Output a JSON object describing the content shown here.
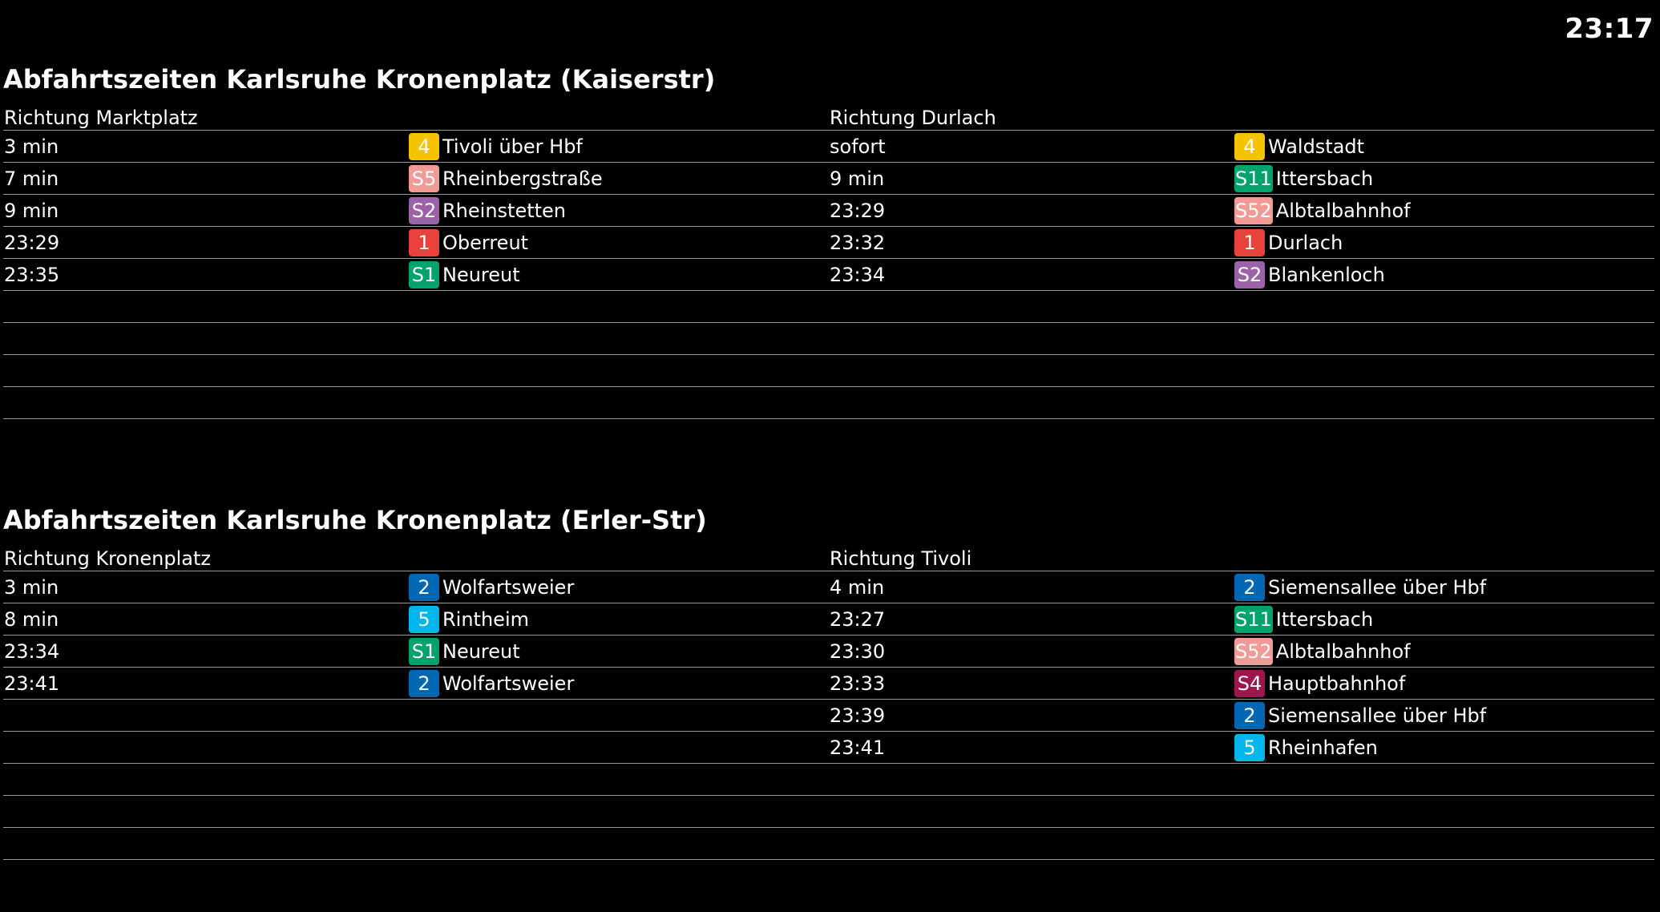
{
  "clock": "23:17",
  "stations": [
    {
      "title": "Abfahrtszeiten Karlsruhe Kronenplatz (Kaiserstr)",
      "directions": [
        {
          "header": "Richtung Marktplatz",
          "departures": [
            {
              "time": "3 min",
              "line": "4",
              "color": "#f5c400",
              "dest": "Tivoli über Hbf"
            },
            {
              "time": "7 min",
              "line": "S5",
              "color": "#f29a95",
              "dest": "Rheinbergstraße"
            },
            {
              "time": "9 min",
              "line": "S2",
              "color": "#9c62a9",
              "dest": "Rheinstetten"
            },
            {
              "time": "23:29",
              "line": "1",
              "color": "#e9423d",
              "dest": "Oberreut"
            },
            {
              "time": "23:35",
              "line": "S1",
              "color": "#00a36c",
              "dest": "Neureut"
            },
            {
              "time": "",
              "line": "",
              "color": "",
              "dest": ""
            },
            {
              "time": "",
              "line": "",
              "color": "",
              "dest": ""
            },
            {
              "time": "",
              "line": "",
              "color": "",
              "dest": ""
            },
            {
              "time": "",
              "line": "",
              "color": "",
              "dest": ""
            }
          ]
        },
        {
          "header": "Richtung Durlach",
          "departures": [
            {
              "time": "sofort",
              "line": "4",
              "color": "#f5c400",
              "dest": "Waldstadt"
            },
            {
              "time": "9 min",
              "line": "S11",
              "color": "#00a36c",
              "dest": "Ittersbach"
            },
            {
              "time": "23:29",
              "line": "S52",
              "color": "#f29a95",
              "dest": "Albtalbahnhof"
            },
            {
              "time": "23:32",
              "line": "1",
              "color": "#e9423d",
              "dest": "Durlach"
            },
            {
              "time": "23:34",
              "line": "S2",
              "color": "#9c62a9",
              "dest": "Blankenloch"
            },
            {
              "time": "",
              "line": "",
              "color": "",
              "dest": ""
            },
            {
              "time": "",
              "line": "",
              "color": "",
              "dest": ""
            },
            {
              "time": "",
              "line": "",
              "color": "",
              "dest": ""
            },
            {
              "time": "",
              "line": "",
              "color": "",
              "dest": ""
            }
          ]
        }
      ]
    },
    {
      "title": "Abfahrtszeiten Karlsruhe Kronenplatz (Erler-Str)",
      "directions": [
        {
          "header": "Richtung Kronenplatz",
          "departures": [
            {
              "time": "3 min",
              "line": "2",
              "color": "#0067b3",
              "dest": "Wolfartsweier"
            },
            {
              "time": "8 min",
              "line": "5",
              "color": "#00b6ea",
              "dest": "Rintheim"
            },
            {
              "time": "23:34",
              "line": "S1",
              "color": "#00a36c",
              "dest": "Neureut"
            },
            {
              "time": "23:41",
              "line": "2",
              "color": "#0067b3",
              "dest": "Wolfartsweier"
            },
            {
              "time": "",
              "line": "",
              "color": "",
              "dest": ""
            },
            {
              "time": "",
              "line": "",
              "color": "",
              "dest": ""
            },
            {
              "time": "",
              "line": "",
              "color": "",
              "dest": ""
            },
            {
              "time": "",
              "line": "",
              "color": "",
              "dest": ""
            },
            {
              "time": "",
              "line": "",
              "color": "",
              "dest": ""
            }
          ]
        },
        {
          "header": "Richtung Tivoli",
          "departures": [
            {
              "time": "4 min",
              "line": "2",
              "color": "#0067b3",
              "dest": "Siemensallee über Hbf"
            },
            {
              "time": "23:27",
              "line": "S11",
              "color": "#00a36c",
              "dest": "Ittersbach"
            },
            {
              "time": "23:30",
              "line": "S52",
              "color": "#f29a95",
              "dest": "Albtalbahnhof"
            },
            {
              "time": "23:33",
              "line": "S4",
              "color": "#a0154e",
              "dest": "Hauptbahnhof"
            },
            {
              "time": "23:39",
              "line": "2",
              "color": "#0067b3",
              "dest": "Siemensallee über Hbf"
            },
            {
              "time": "23:41",
              "line": "5",
              "color": "#00b6ea",
              "dest": "Rheinhafen"
            },
            {
              "time": "",
              "line": "",
              "color": "",
              "dest": ""
            },
            {
              "time": "",
              "line": "",
              "color": "",
              "dest": ""
            },
            {
              "time": "",
              "line": "",
              "color": "",
              "dest": ""
            }
          ]
        }
      ]
    }
  ]
}
